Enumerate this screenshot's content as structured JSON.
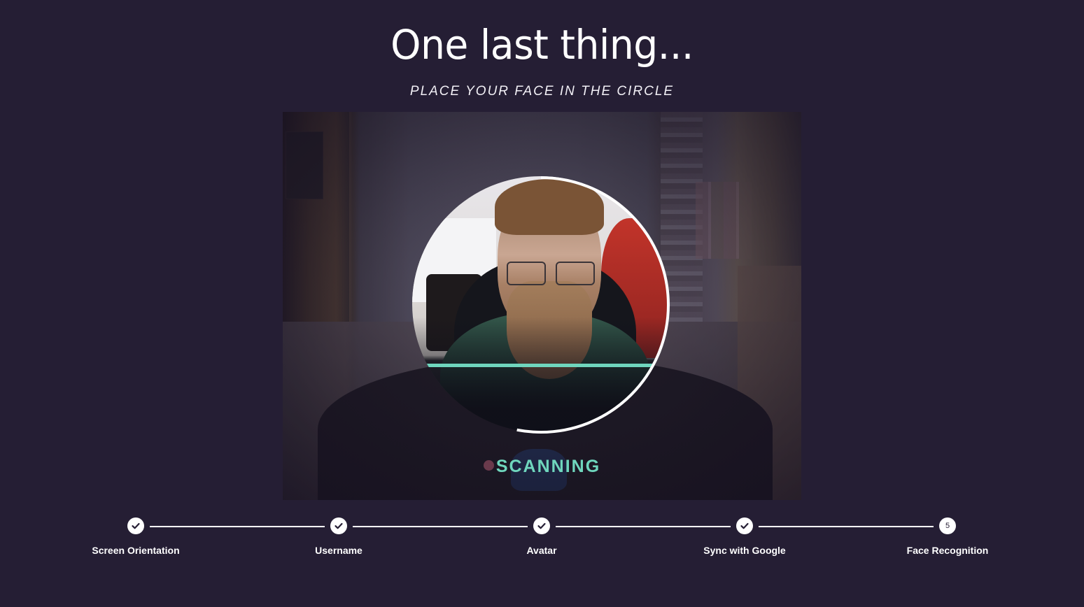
{
  "header": {
    "title": "One last thing...",
    "subtitle": "PLACE YOUR FACE IN THE CIRCLE"
  },
  "scanner": {
    "status": "SCANNING",
    "progress_fraction": 0.53,
    "accent_color": "#6fd6bd",
    "background_color": "#251e34"
  },
  "stepper": {
    "steps": [
      {
        "label": "Screen Orientation",
        "state": "completed",
        "icon": "check-icon"
      },
      {
        "label": "Username",
        "state": "completed",
        "icon": "check-icon"
      },
      {
        "label": "Avatar",
        "state": "completed",
        "icon": "check-icon"
      },
      {
        "label": "Sync with Google",
        "state": "completed",
        "icon": "check-icon"
      },
      {
        "label": "Face Recognition",
        "state": "active",
        "number": "5"
      }
    ]
  }
}
